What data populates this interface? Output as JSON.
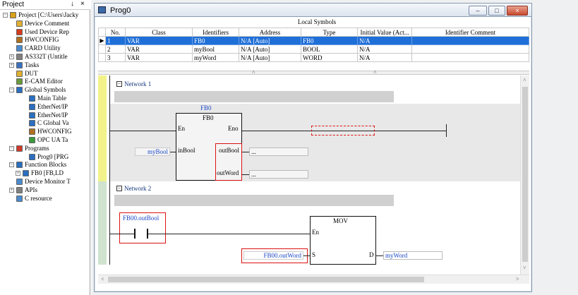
{
  "project_panel": {
    "title": "Project",
    "pin": "↓",
    "close": "×",
    "items": [
      {
        "label": "Project [C:\\Users\\Jacky",
        "indent": 0,
        "expander": "−",
        "icon": "project-icon",
        "color": "#d9a21b"
      },
      {
        "label": "Device Comment",
        "indent": 1,
        "icon": "comment-icon",
        "color": "#e0b030"
      },
      {
        "label": "Used Device Rep",
        "indent": 1,
        "icon": "report-icon",
        "color": "#d63b1f"
      },
      {
        "label": "HWCONFIG",
        "indent": 1,
        "icon": "hwconfig-icon",
        "color": "#b07020"
      },
      {
        "label": "CARD Utility",
        "indent": 1,
        "icon": "card-icon",
        "color": "#4a8bd0"
      },
      {
        "label": "AS332T (Untitle",
        "indent": 1,
        "expander": "+",
        "icon": "module-icon",
        "color": "#808080"
      },
      {
        "label": "Tasks",
        "indent": 1,
        "expander": "+",
        "icon": "tasks-icon",
        "color": "#3a70c0"
      },
      {
        "label": "DUT",
        "indent": 1,
        "icon": "dut-icon",
        "color": "#e0b030"
      },
      {
        "label": "E-CAM Editor",
        "indent": 1,
        "icon": "ecam-icon",
        "color": "#6a9a3a"
      },
      {
        "label": "Global Symbols",
        "indent": 1,
        "expander": "−",
        "icon": "globe-icon",
        "color": "#2a6fc0"
      },
      {
        "label": "Main Table",
        "indent": 3,
        "icon": "table-icon",
        "color": "#2a6fc0"
      },
      {
        "label": "EtherNet/IP",
        "indent": 3,
        "icon": "ethernet-icon",
        "color": "#2a6fc0"
      },
      {
        "label": "EtherNet/IP",
        "indent": 3,
        "icon": "ethernet-icon",
        "color": "#2a6fc0"
      },
      {
        "label": "C Global Va",
        "indent": 3,
        "icon": "c-global-icon",
        "color": "#2a6fc0"
      },
      {
        "label": "HWCONFIG",
        "indent": 3,
        "icon": "hwconfig-icon",
        "color": "#b07020"
      },
      {
        "label": "OPC UA Ta",
        "indent": 3,
        "icon": "opcua-icon",
        "color": "#3a9a3a"
      },
      {
        "label": "Programs",
        "indent": 1,
        "expander": "−",
        "icon": "programs-icon",
        "color": "#d03a2a"
      },
      {
        "label": "Prog0 [PRG",
        "indent": 3,
        "icon": "program-icon",
        "color": "#2a6fc0"
      },
      {
        "label": "Function Blocks",
        "indent": 1,
        "expander": "−",
        "icon": "function-blocks-icon",
        "color": "#2a6fc0"
      },
      {
        "label": "FB0 [FB,LD",
        "indent": 2,
        "expander": "+",
        "icon": "function-block-icon",
        "color": "#2a6fc0"
      },
      {
        "label": "Device Monitor T",
        "indent": 1,
        "icon": "monitor-icon",
        "color": "#4a8bd0"
      },
      {
        "label": "APIs",
        "indent": 1,
        "expander": "+",
        "icon": "api-icon",
        "color": "#808080"
      },
      {
        "label": "C resource",
        "indent": 1,
        "icon": "c-resource-icon",
        "color": "#4a8bd0"
      }
    ]
  },
  "window": {
    "title": "Prog0",
    "buttons": {
      "minimize": "–",
      "maximize": "□",
      "close": "×"
    }
  },
  "local_symbols": {
    "caption": "Local Symbols",
    "columns": [
      "No.",
      "Class",
      "Identifiers",
      "Address",
      "Type",
      "Initial Value (Act...",
      "Identifier Comment"
    ],
    "rows": [
      {
        "no": "1",
        "class": "VAR",
        "identifier": "FB0",
        "address": "N/A [Auto]",
        "type": "FB0",
        "initial": "N/A",
        "comment": "",
        "selected": true
      },
      {
        "no": "2",
        "class": "VAR",
        "identifier": "myBool",
        "address": "N/A [Auto]",
        "type": "BOOL",
        "initial": "N/A",
        "comment": "",
        "selected": false
      },
      {
        "no": "3",
        "class": "VAR",
        "identifier": "myWord",
        "address": "N/A [Auto]",
        "type": "WORD",
        "initial": "N/A",
        "comment": "",
        "selected": false
      }
    ],
    "selection_arrow": "▶"
  },
  "ladder": {
    "network1": {
      "expander": "−",
      "title": "Network 1",
      "fb_instance": "FB0",
      "fb_type": "FB0",
      "pin_en": "En",
      "pin_eno": "Eno",
      "pin_in_bool": "inBool",
      "pin_out_bool": "outBool",
      "pin_out_word": "outWord",
      "input_var": "myBool",
      "out_field1": "...",
      "out_field2": "..."
    },
    "network2": {
      "expander": "−",
      "title": "Network 2",
      "contact_var": "FB00.outBool",
      "mov_title": "MOV",
      "pin_en": "En",
      "pin_s": "S",
      "pin_d": "D",
      "s_var": "FB00.outWord",
      "d_var": "myWord"
    }
  },
  "scroll": {
    "up": "˄",
    "down": "˅",
    "left": "<",
    "right": ">",
    "split_arrow": "˄"
  },
  "colors": {
    "selection": "#1f6fd8",
    "highlight": "#dd1111",
    "rail_network1": "#f2f28a",
    "rail_network2": "#cfe3cf",
    "variable_text": "#1a47c6"
  }
}
